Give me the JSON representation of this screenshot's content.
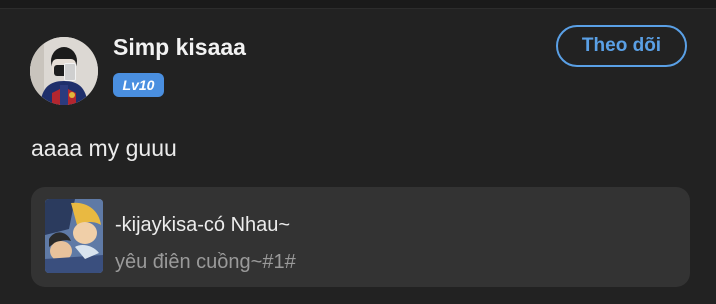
{
  "post": {
    "author": {
      "name": "Simp kisaaa",
      "level": "Lv10",
      "avatar_icon": "user-avatar-photo"
    },
    "follow_label": "Theo dõi",
    "text": "aaaa my guuu",
    "song": {
      "title": "-kijaykisa-có Nhau~",
      "subtitle": "yêu điên cuồng~#1#",
      "cover_icon": "song-cover-art"
    }
  },
  "colors": {
    "background": "#222222",
    "card": "#333333",
    "accent": "#5aa0e6",
    "badge": "#4a8fe0",
    "text_primary": "#ececec",
    "text_secondary": "#9a9a9a"
  }
}
